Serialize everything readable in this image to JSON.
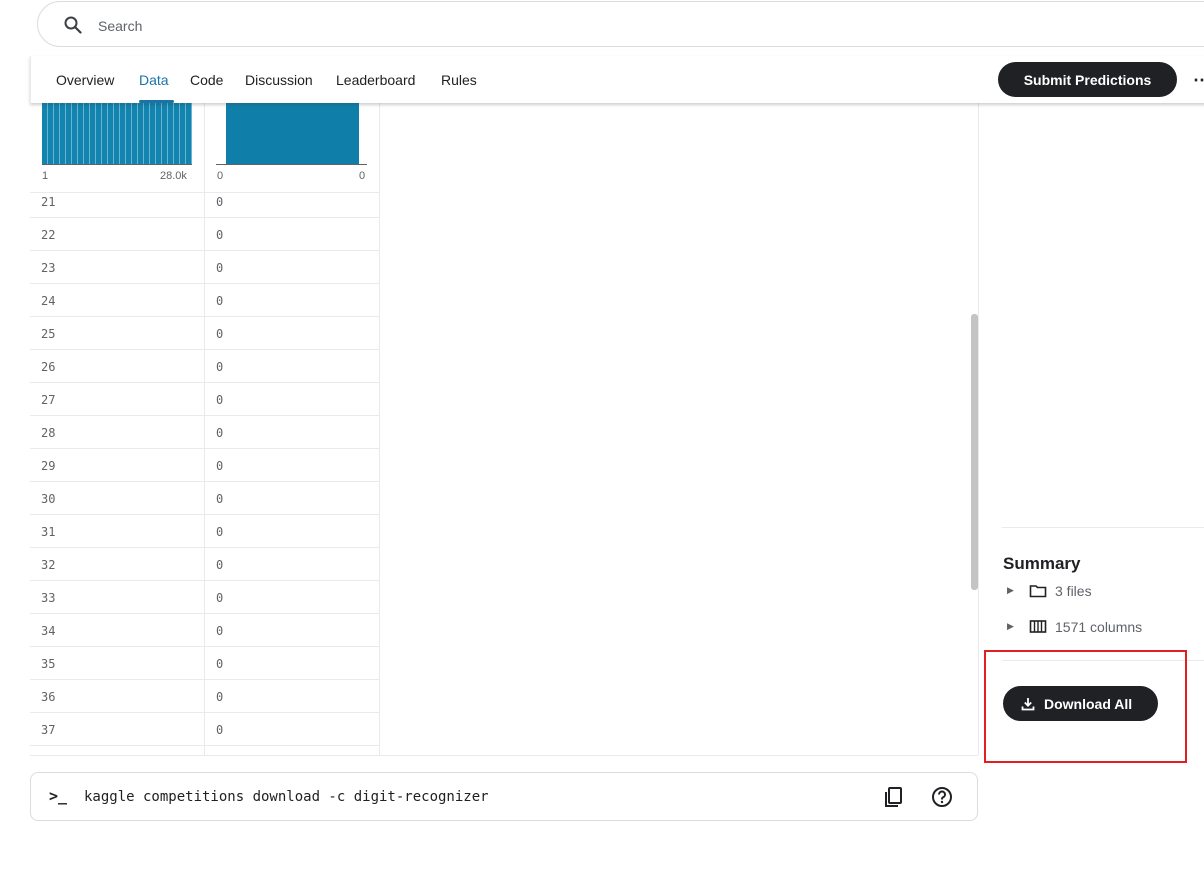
{
  "search": {
    "placeholder": "Search"
  },
  "tabs": [
    "Overview",
    "Data",
    "Code",
    "Discussion",
    "Leaderboard",
    "Rules"
  ],
  "active_tab": "Data",
  "submit_label": "Submit Predictions",
  "more_label": "⋯",
  "histograms": [
    {
      "min_label": "1",
      "max_label": "28.0k"
    },
    {
      "min_label": "0",
      "max_label": "0"
    }
  ],
  "rows": [
    {
      "id": "21",
      "value": "0"
    },
    {
      "id": "22",
      "value": "0"
    },
    {
      "id": "23",
      "value": "0"
    },
    {
      "id": "24",
      "value": "0"
    },
    {
      "id": "25",
      "value": "0"
    },
    {
      "id": "26",
      "value": "0"
    },
    {
      "id": "27",
      "value": "0"
    },
    {
      "id": "28",
      "value": "0"
    },
    {
      "id": "29",
      "value": "0"
    },
    {
      "id": "30",
      "value": "0"
    },
    {
      "id": "31",
      "value": "0"
    },
    {
      "id": "32",
      "value": "0"
    },
    {
      "id": "33",
      "value": "0"
    },
    {
      "id": "34",
      "value": "0"
    },
    {
      "id": "35",
      "value": "0"
    },
    {
      "id": "36",
      "value": "0"
    },
    {
      "id": "37",
      "value": "0"
    }
  ],
  "command": {
    "prompt": ">_",
    "text": "kaggle competitions download -c digit-recognizer"
  },
  "summary": {
    "title": "Summary",
    "files": "3 files",
    "columns": "1571 columns"
  },
  "download_label": "Download All",
  "highlight_color": "#e02020"
}
